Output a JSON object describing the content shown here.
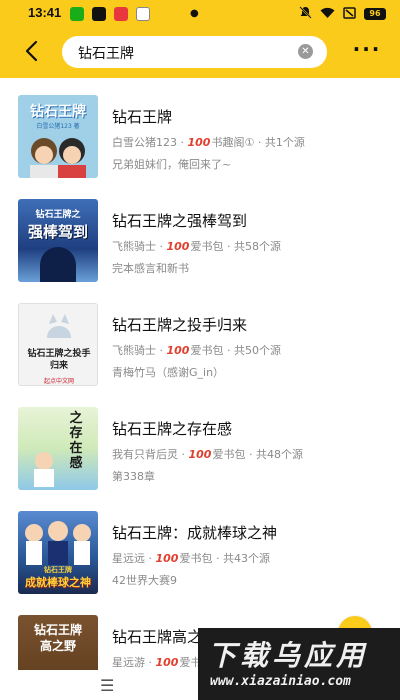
{
  "status_bar": {
    "time": "13:41",
    "battery": "96"
  },
  "search": {
    "query": "钻石王牌"
  },
  "results": [
    {
      "title": "钻石王牌",
      "author": "白雪公猪123",
      "source": "书趣阁①",
      "source_count": "共1个源",
      "description": "兄弟姐妹们，俺回来了~",
      "cover_text": "钻石王牌",
      "cover_subtitle": "白雪公猪123 著",
      "cover_color": "#9fd0e8"
    },
    {
      "title": "钻石王牌之强棒驾到",
      "author": "飞熊骑士",
      "source": "爱书包",
      "source_count": "共58个源",
      "description": "完本感言和新书",
      "cover_text": "强棒驾到",
      "cover_subtitle": "钻石王牌之",
      "cover_color": "#1f3f80"
    },
    {
      "title": "钻石王牌之投手归来",
      "author": "飞熊骑士",
      "source": "爱书包",
      "source_count": "共50个源",
      "description": "青梅竹马（感谢G_in）",
      "cover_text": "钻石王牌之投手归来",
      "cover_subtitle": "起点中文网",
      "cover_color": "#f3f3f3"
    },
    {
      "title": "钻石王牌之存在感",
      "author": "我有只背后灵",
      "source": "爱书包",
      "source_count": "共48个源",
      "description": "第338章",
      "cover_text": "之存在感",
      "cover_subtitle": "",
      "cover_color": "#cfe9b8"
    },
    {
      "title": "钻石王牌：成就棒球之神",
      "author": "星远远",
      "source": "爱书包",
      "source_count": "共43个源",
      "description": "42世界大赛9",
      "cover_text": "成就棒球之神",
      "cover_subtitle": "钻石王牌",
      "cover_color": "#2a5a9a"
    },
    {
      "title": "钻石王牌高之野",
      "author": "星远游",
      "source": "爱书包",
      "source_count": "",
      "description": "",
      "cover_text": "钻石王牌",
      "cover_subtitle": "高之野",
      "cover_color": "#5a3a1a"
    }
  ],
  "source_badge": "100",
  "watermark": {
    "title": "下载乌应用",
    "url": "www.xiazainiao.com"
  },
  "colors": {
    "accent": "#FBCB1C",
    "meta_text": "#8a8a8a",
    "source_badge": "#e04030"
  }
}
